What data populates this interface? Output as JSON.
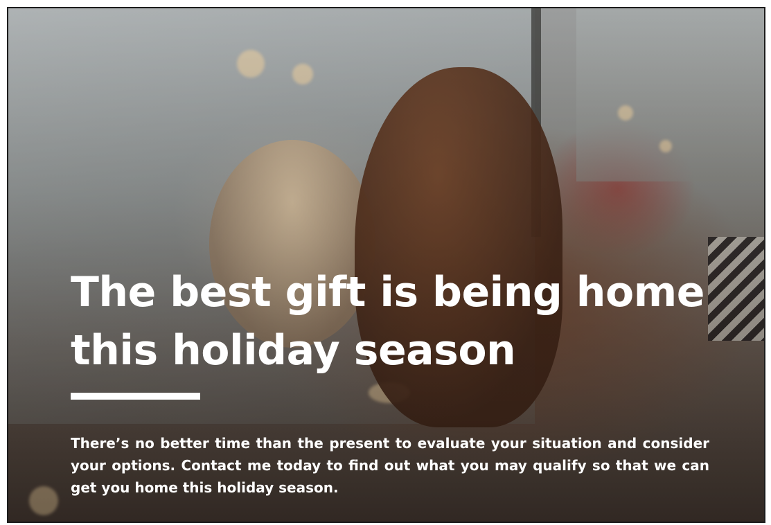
{
  "banner": {
    "headline": "The best gift is being home this holiday season",
    "body": "There’s no better time than the present to evaluate your situation and consider your options. Contact me today to find out what you may qualify so that we can get you home this holiday season."
  },
  "colors": {
    "text": "#ffffff",
    "border": "#1c1c1c"
  }
}
